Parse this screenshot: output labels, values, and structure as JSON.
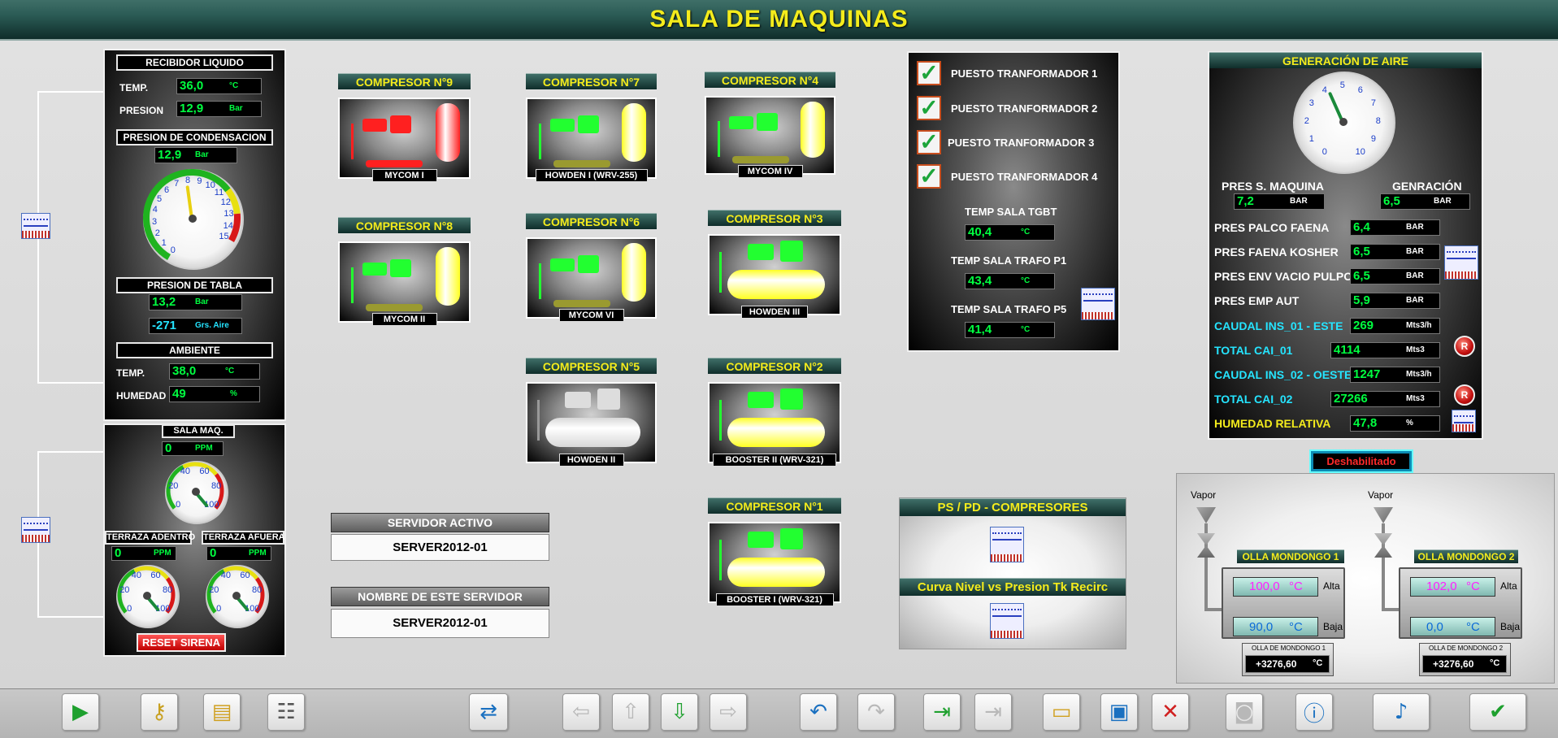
{
  "title": "SALA DE MAQUINAS",
  "recibidor": {
    "header": "RECIBIDOR LIQUIDO",
    "temp_label": "TEMP.",
    "temp_value": "36,0",
    "temp_unit": "°C",
    "presion_label": "PRESION",
    "presion_value": "12,9",
    "presion_unit": "Bar"
  },
  "condensacion": {
    "header": "PRESION DE CONDENSACION",
    "value": "12,9",
    "unit": "Bar",
    "ticks": [
      "0",
      "1",
      "2",
      "3",
      "4",
      "5",
      "6",
      "7",
      "8",
      "9",
      "10",
      "11",
      "12",
      "13",
      "14",
      "15"
    ]
  },
  "tabla": {
    "header": "PRESION DE TABLA",
    "value": "13,2",
    "unit": "Bar",
    "aire_value": "-271",
    "aire_unit": "Grs. Aire"
  },
  "ambiente": {
    "header": "AMBIENTE",
    "temp_label": "TEMP.",
    "temp_value": "38,0",
    "temp_unit": "°C",
    "hum_label": "HUMEDAD",
    "hum_value": "49",
    "hum_unit": "%"
  },
  "sala_maq": {
    "header": "SALA MAQ.",
    "value": "0",
    "unit": "PPM",
    "ticks": [
      "0",
      "20",
      "40",
      "60",
      "80",
      "100"
    ]
  },
  "terraza_adentro": {
    "header": "TERRAZA ADENTRO",
    "value": "0",
    "unit": "PPM",
    "ticks": [
      "0",
      "20",
      "40",
      "60",
      "80",
      "100"
    ]
  },
  "terraza_afuera": {
    "header": "TERRAZA AFUERA",
    "value": "0",
    "unit": "PPM",
    "ticks": [
      "0",
      "20",
      "40",
      "60",
      "80",
      "100"
    ]
  },
  "reset_sirena": "RESET SIRENA",
  "compresores": [
    {
      "title": "COMPRESOR N°9",
      "label": "MYCOM I"
    },
    {
      "title": "COMPRESOR N°7",
      "label": "HOWDEN I (WRV-255)"
    },
    {
      "title": "COMPRESOR N°4",
      "label": "MYCOM IV"
    },
    {
      "title": "COMPRESOR N°8",
      "label": "MYCOM II"
    },
    {
      "title": "COMPRESOR N°6",
      "label": "MYCOM VI"
    },
    {
      "title": "COMPRESOR N°3",
      "label": "HOWDEN III"
    },
    {
      "title": "COMPRESOR N°5",
      "label": "HOWDEN II"
    },
    {
      "title": "COMPRESOR N°2",
      "label": "BOOSTER II (WRV-321)"
    },
    {
      "title": "COMPRESOR N°1",
      "label": "BOOSTER I (WRV-321)"
    }
  ],
  "servidor": {
    "activo_header": "SERVIDOR ACTIVO",
    "activo_value": "SERVER2012-01",
    "nombre_header": "NOMBRE DE ESTE SERVIDOR",
    "nombre_value": "SERVER2012-01"
  },
  "transformadores": {
    "items": [
      "PUESTO TRANFORMADOR 1",
      "PUESTO TRANFORMADOR 2",
      "PUESTO TRANFORMADOR 3",
      "PUESTO TRANFORMADOR 4"
    ],
    "tgbt_label": "TEMP SALA TGBT",
    "tgbt_value": "40,4",
    "p1_label": "TEMP SALA TRAFO P1",
    "p1_value": "43,4",
    "p5_label": "TEMP SALA TRAFO P5",
    "p5_value": "41,4",
    "unit": "°C"
  },
  "ps_pd": {
    "title": "PS / PD -  COMPRESORES",
    "curva": "Curva Nivel vs Presion Tk Recirc"
  },
  "aire": {
    "header": "GENERACIÓN DE AIRE",
    "gauge_ticks": [
      "0",
      "1",
      "2",
      "3",
      "4",
      "5",
      "6",
      "7",
      "8",
      "9",
      "10"
    ],
    "pres_s_label": "PRES S. MAQUINA",
    "pres_s_value": "7,2",
    "gen_label": "GENRACIÓN",
    "gen_value": "6,5",
    "bar": "BAR",
    "rows": [
      {
        "label": "PRES PALCO FAENA",
        "value": "6,4",
        "unit": "BAR",
        "color": "white"
      },
      {
        "label": "PRES FAENA KOSHER",
        "value": "6,5",
        "unit": "BAR",
        "color": "white"
      },
      {
        "label": "PRES ENV VACIO PULPO",
        "value": "6,5",
        "unit": "BAR",
        "color": "white"
      },
      {
        "label": "PRES EMP AUT",
        "value": "5,9",
        "unit": "BAR",
        "color": "white"
      },
      {
        "label": "CAUDAL INS_01 - ESTE",
        "value": "269",
        "unit": "Mts3/h",
        "color": "cyan"
      },
      {
        "label": "TOTAL CAI_01",
        "value": "4114",
        "unit": "Mts3",
        "color": "cyan"
      },
      {
        "label": "CAUDAL INS_02 - OESTE",
        "value": "1247",
        "unit": "Mts3/h",
        "color": "cyan"
      },
      {
        "label": "TOTAL CAI_02",
        "value": "27266",
        "unit": "Mts3",
        "color": "cyan"
      },
      {
        "label": "HUMEDAD RELATIVA",
        "value": "47,8",
        "unit": "%",
        "color": "yellow"
      }
    ],
    "reset_icon": "R"
  },
  "deshabilitado": "Deshabilitado",
  "ollas": [
    {
      "vapor": "Vapor",
      "title": "OLLA MONDONGO 1",
      "alta_value": "100,0",
      "baja_value": "90,0",
      "unit": "°C",
      "alta": "Alta",
      "baja": "Baja",
      "sub": "OLLA DE MONDONGO 1",
      "sub_value": "+3276,60",
      "sub_unit": "°C"
    },
    {
      "vapor": "Vapor",
      "title": "OLLA MONDONGO 2",
      "alta_value": "102,0",
      "baja_value": "0,0",
      "unit": "°C",
      "alta": "Alta",
      "baja": "Baja",
      "sub": "OLLA DE MONDONGO 2",
      "sub_value": "+3276,60",
      "sub_unit": "°C"
    }
  ],
  "toolbar": [
    "play-icon",
    "keys-icon",
    "notepad-icon",
    "checklist-icon",
    "screen-transfer-icon",
    "arrow-left-icon",
    "arrow-up-icon",
    "arrow-down-icon",
    "arrow-right-icon",
    "undo-icon",
    "redo-icon",
    "enter-screen-icon",
    "exit-screen-icon",
    "open-folder-icon",
    "save-icon",
    "delete-icon",
    "monitor-eye-icon",
    "info-icon",
    "sound-check-icon",
    "double-check-icon"
  ]
}
